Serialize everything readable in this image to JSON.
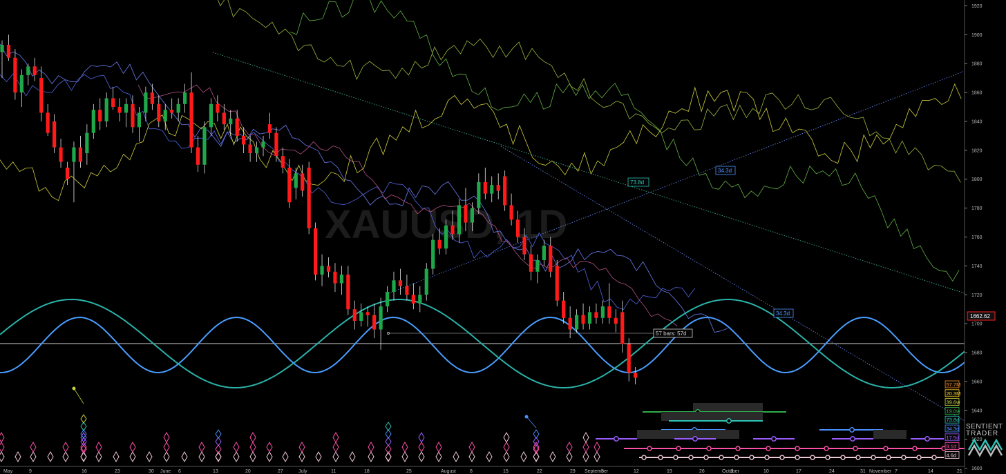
{
  "chart_data": {
    "type": "candlestick",
    "instrument_watermark": "XAUUSD, 1D",
    "y_axis": {
      "ticks": [
        1920,
        1900,
        1880,
        1860,
        1840,
        1820,
        1800,
        1780,
        1760,
        1740,
        1720,
        1700,
        1680,
        1660,
        1640,
        1620,
        1600
      ],
      "ylim": [
        1596,
        1924
      ]
    },
    "x_axis": {
      "labels": [
        "May",
        "9",
        "16",
        "23",
        "30",
        "June",
        "6",
        "13",
        "20",
        "27",
        "July",
        "11",
        "18",
        "25",
        "August",
        "8",
        "15",
        "22",
        "29",
        "September",
        "5",
        "12",
        "19",
        "26",
        "October",
        "3",
        "10",
        "17",
        "24",
        "31",
        "November",
        "7",
        "14",
        "21"
      ]
    },
    "current_price": "1662.62",
    "current_price_color": "#ff2020",
    "candles": [
      {
        "i": 0,
        "o": 1888,
        "h": 1896,
        "l": 1870,
        "c": 1893
      },
      {
        "i": 1,
        "o": 1893,
        "h": 1900,
        "l": 1882,
        "c": 1884
      },
      {
        "i": 2,
        "o": 1884,
        "h": 1890,
        "l": 1855,
        "c": 1860
      },
      {
        "i": 3,
        "o": 1860,
        "h": 1876,
        "l": 1850,
        "c": 1872
      },
      {
        "i": 4,
        "o": 1872,
        "h": 1880,
        "l": 1865,
        "c": 1878
      },
      {
        "i": 5,
        "o": 1878,
        "h": 1884,
        "l": 1868,
        "c": 1872
      },
      {
        "i": 6,
        "o": 1870,
        "h": 1878,
        "l": 1840,
        "c": 1846
      },
      {
        "i": 7,
        "o": 1846,
        "h": 1852,
        "l": 1830,
        "c": 1832
      },
      {
        "i": 8,
        "o": 1840,
        "h": 1845,
        "l": 1818,
        "c": 1822
      },
      {
        "i": 9,
        "o": 1822,
        "h": 1828,
        "l": 1808,
        "c": 1812
      },
      {
        "i": 10,
        "o": 1808,
        "h": 1812,
        "l": 1796,
        "c": 1800
      },
      {
        "i": 11,
        "o": 1812,
        "h": 1826,
        "l": 1784,
        "c": 1822
      },
      {
        "i": 12,
        "o": 1822,
        "h": 1830,
        "l": 1808,
        "c": 1812
      },
      {
        "i": 13,
        "o": 1818,
        "h": 1838,
        "l": 1810,
        "c": 1832
      },
      {
        "i": 14,
        "o": 1832,
        "h": 1852,
        "l": 1828,
        "c": 1848
      },
      {
        "i": 15,
        "o": 1848,
        "h": 1856,
        "l": 1834,
        "c": 1840
      },
      {
        "i": 16,
        "o": 1840,
        "h": 1860,
        "l": 1836,
        "c": 1856
      },
      {
        "i": 17,
        "o": 1856,
        "h": 1864,
        "l": 1848,
        "c": 1850
      },
      {
        "i": 18,
        "o": 1850,
        "h": 1856,
        "l": 1840,
        "c": 1846
      },
      {
        "i": 19,
        "o": 1846,
        "h": 1856,
        "l": 1836,
        "c": 1852
      },
      {
        "i": 20,
        "o": 1852,
        "h": 1858,
        "l": 1832,
        "c": 1836
      },
      {
        "i": 21,
        "o": 1836,
        "h": 1850,
        "l": 1826,
        "c": 1846
      },
      {
        "i": 22,
        "o": 1846,
        "h": 1864,
        "l": 1840,
        "c": 1860
      },
      {
        "i": 23,
        "o": 1860,
        "h": 1866,
        "l": 1848,
        "c": 1852
      },
      {
        "i": 24,
        "o": 1852,
        "h": 1858,
        "l": 1836,
        "c": 1840
      },
      {
        "i": 25,
        "o": 1840,
        "h": 1852,
        "l": 1834,
        "c": 1848
      },
      {
        "i": 26,
        "o": 1848,
        "h": 1856,
        "l": 1842,
        "c": 1846
      },
      {
        "i": 27,
        "o": 1846,
        "h": 1856,
        "l": 1840,
        "c": 1852
      },
      {
        "i": 28,
        "o": 1852,
        "h": 1866,
        "l": 1846,
        "c": 1860
      },
      {
        "i": 29,
        "o": 1860,
        "h": 1874,
        "l": 1818,
        "c": 1822
      },
      {
        "i": 30,
        "o": 1822,
        "h": 1830,
        "l": 1805,
        "c": 1810
      },
      {
        "i": 31,
        "o": 1810,
        "h": 1840,
        "l": 1804,
        "c": 1836
      },
      {
        "i": 32,
        "o": 1836,
        "h": 1856,
        "l": 1830,
        "c": 1852
      },
      {
        "i": 33,
        "o": 1852,
        "h": 1858,
        "l": 1840,
        "c": 1846
      },
      {
        "i": 34,
        "o": 1846,
        "h": 1852,
        "l": 1834,
        "c": 1838
      },
      {
        "i": 35,
        "o": 1838,
        "h": 1848,
        "l": 1830,
        "c": 1842
      },
      {
        "i": 36,
        "o": 1842,
        "h": 1848,
        "l": 1826,
        "c": 1830
      },
      {
        "i": 37,
        "o": 1830,
        "h": 1836,
        "l": 1818,
        "c": 1824
      },
      {
        "i": 38,
        "o": 1824,
        "h": 1830,
        "l": 1812,
        "c": 1818
      },
      {
        "i": 39,
        "o": 1818,
        "h": 1826,
        "l": 1812,
        "c": 1822
      },
      {
        "i": 40,
        "o": 1822,
        "h": 1830,
        "l": 1816,
        "c": 1826
      },
      {
        "i": 41,
        "o": 1838,
        "h": 1846,
        "l": 1828,
        "c": 1832
      },
      {
        "i": 42,
        "o": 1832,
        "h": 1836,
        "l": 1812,
        "c": 1816
      },
      {
        "i": 43,
        "o": 1816,
        "h": 1822,
        "l": 1804,
        "c": 1808
      },
      {
        "i": 44,
        "o": 1808,
        "h": 1814,
        "l": 1780,
        "c": 1784
      },
      {
        "i": 45,
        "o": 1794,
        "h": 1808,
        "l": 1786,
        "c": 1804
      },
      {
        "i": 46,
        "o": 1804,
        "h": 1810,
        "l": 1788,
        "c": 1792
      },
      {
        "i": 47,
        "o": 1808,
        "h": 1812,
        "l": 1762,
        "c": 1766
      },
      {
        "i": 48,
        "o": 1766,
        "h": 1770,
        "l": 1730,
        "c": 1734
      },
      {
        "i": 49,
        "o": 1734,
        "h": 1748,
        "l": 1726,
        "c": 1740
      },
      {
        "i": 50,
        "o": 1740,
        "h": 1746,
        "l": 1732,
        "c": 1736
      },
      {
        "i": 51,
        "o": 1736,
        "h": 1742,
        "l": 1722,
        "c": 1728
      },
      {
        "i": 52,
        "o": 1728,
        "h": 1740,
        "l": 1720,
        "c": 1734
      },
      {
        "i": 53,
        "o": 1734,
        "h": 1740,
        "l": 1706,
        "c": 1710
      },
      {
        "i": 54,
        "o": 1710,
        "h": 1716,
        "l": 1696,
        "c": 1702
      },
      {
        "i": 55,
        "o": 1702,
        "h": 1714,
        "l": 1698,
        "c": 1708
      },
      {
        "i": 56,
        "o": 1708,
        "h": 1712,
        "l": 1698,
        "c": 1706
      },
      {
        "i": 57,
        "o": 1706,
        "h": 1714,
        "l": 1690,
        "c": 1696
      },
      {
        "i": 58,
        "o": 1696,
        "h": 1718,
        "l": 1682,
        "c": 1712
      },
      {
        "i": 59,
        "o": 1712,
        "h": 1726,
        "l": 1708,
        "c": 1722
      },
      {
        "i": 60,
        "o": 1722,
        "h": 1736,
        "l": 1716,
        "c": 1730
      },
      {
        "i": 61,
        "o": 1730,
        "h": 1738,
        "l": 1720,
        "c": 1726
      },
      {
        "i": 62,
        "o": 1726,
        "h": 1734,
        "l": 1716,
        "c": 1720
      },
      {
        "i": 63,
        "o": 1720,
        "h": 1728,
        "l": 1710,
        "c": 1714
      },
      {
        "i": 64,
        "o": 1714,
        "h": 1726,
        "l": 1708,
        "c": 1720
      },
      {
        "i": 65,
        "o": 1720,
        "h": 1742,
        "l": 1716,
        "c": 1738
      },
      {
        "i": 66,
        "o": 1738,
        "h": 1762,
        "l": 1734,
        "c": 1758
      },
      {
        "i": 67,
        "o": 1758,
        "h": 1766,
        "l": 1748,
        "c": 1752
      },
      {
        "i": 68,
        "o": 1752,
        "h": 1772,
        "l": 1748,
        "c": 1768
      },
      {
        "i": 69,
        "o": 1768,
        "h": 1778,
        "l": 1758,
        "c": 1762
      },
      {
        "i": 70,
        "o": 1762,
        "h": 1786,
        "l": 1756,
        "c": 1782
      },
      {
        "i": 71,
        "o": 1782,
        "h": 1794,
        "l": 1764,
        "c": 1770
      },
      {
        "i": 72,
        "o": 1770,
        "h": 1784,
        "l": 1764,
        "c": 1780
      },
      {
        "i": 73,
        "o": 1780,
        "h": 1804,
        "l": 1776,
        "c": 1798
      },
      {
        "i": 74,
        "o": 1798,
        "h": 1808,
        "l": 1786,
        "c": 1790
      },
      {
        "i": 75,
        "o": 1790,
        "h": 1802,
        "l": 1784,
        "c": 1796
      },
      {
        "i": 76,
        "o": 1796,
        "h": 1804,
        "l": 1786,
        "c": 1792
      },
      {
        "i": 77,
        "o": 1802,
        "h": 1806,
        "l": 1778,
        "c": 1782
      },
      {
        "i": 78,
        "o": 1782,
        "h": 1790,
        "l": 1768,
        "c": 1772
      },
      {
        "i": 79,
        "o": 1772,
        "h": 1778,
        "l": 1756,
        "c": 1760
      },
      {
        "i": 80,
        "o": 1760,
        "h": 1766,
        "l": 1744,
        "c": 1748
      },
      {
        "i": 81,
        "o": 1748,
        "h": 1754,
        "l": 1730,
        "c": 1736
      },
      {
        "i": 82,
        "o": 1736,
        "h": 1748,
        "l": 1728,
        "c": 1744
      },
      {
        "i": 83,
        "o": 1744,
        "h": 1758,
        "l": 1740,
        "c": 1754
      },
      {
        "i": 84,
        "o": 1754,
        "h": 1760,
        "l": 1732,
        "c": 1736
      },
      {
        "i": 85,
        "o": 1740,
        "h": 1744,
        "l": 1712,
        "c": 1716
      },
      {
        "i": 86,
        "o": 1716,
        "h": 1722,
        "l": 1700,
        "c": 1704
      },
      {
        "i": 87,
        "o": 1704,
        "h": 1712,
        "l": 1690,
        "c": 1696
      },
      {
        "i": 88,
        "o": 1696,
        "h": 1710,
        "l": 1694,
        "c": 1706
      },
      {
        "i": 89,
        "o": 1706,
        "h": 1714,
        "l": 1696,
        "c": 1700
      },
      {
        "i": 90,
        "o": 1700,
        "h": 1712,
        "l": 1696,
        "c": 1708
      },
      {
        "i": 91,
        "o": 1708,
        "h": 1714,
        "l": 1700,
        "c": 1704
      },
      {
        "i": 92,
        "o": 1704,
        "h": 1716,
        "l": 1700,
        "c": 1712
      },
      {
        "i": 93,
        "o": 1712,
        "h": 1728,
        "l": 1700,
        "c": 1704
      },
      {
        "i": 94,
        "o": 1704,
        "h": 1710,
        "l": 1694,
        "c": 1700
      },
      {
        "i": 95,
        "o": 1708,
        "h": 1716,
        "l": 1680,
        "c": 1686
      },
      {
        "i": 96,
        "o": 1686,
        "h": 1690,
        "l": 1660,
        "c": 1666
      },
      {
        "i": 97,
        "o": 1666,
        "h": 1670,
        "l": 1658,
        "c": 1662.62
      }
    ],
    "cycle_labels": [
      {
        "text": "73.8d",
        "color": "#2ec4b6"
      },
      {
        "text": "34.3d",
        "color": "#4a90ff"
      },
      {
        "text": "34.3d",
        "color": "#4a90ff"
      },
      {
        "text": "57 bars: 57d",
        "color": "#d0d0d0"
      }
    ],
    "cycle_legend": [
      {
        "text": "57.7M",
        "color": "#ff8a1f"
      },
      {
        "text": "20.3M",
        "color": "#ffd21f"
      },
      {
        "text": "39.6w",
        "color": "#c8d23a"
      },
      {
        "text": "19.0w",
        "color": "#2fae4a"
      },
      {
        "text": "73.8d",
        "color": "#2ec4b6"
      },
      {
        "text": "34.3d",
        "color": "#4a90ff"
      },
      {
        "text": "17.5d",
        "color": "#9a5cff"
      },
      {
        "text": "9.1d",
        "color": "#ff4fa8"
      },
      {
        "text": "4.6d",
        "color": "#f0c8d8"
      }
    ],
    "brand": {
      "line1": "SENTIENT",
      "line2": "TRADER"
    },
    "colors": {
      "up": "#1ea84a",
      "down": "#ff1a1a",
      "background": "#000000",
      "axis_text": "#b8b8b8"
    }
  }
}
